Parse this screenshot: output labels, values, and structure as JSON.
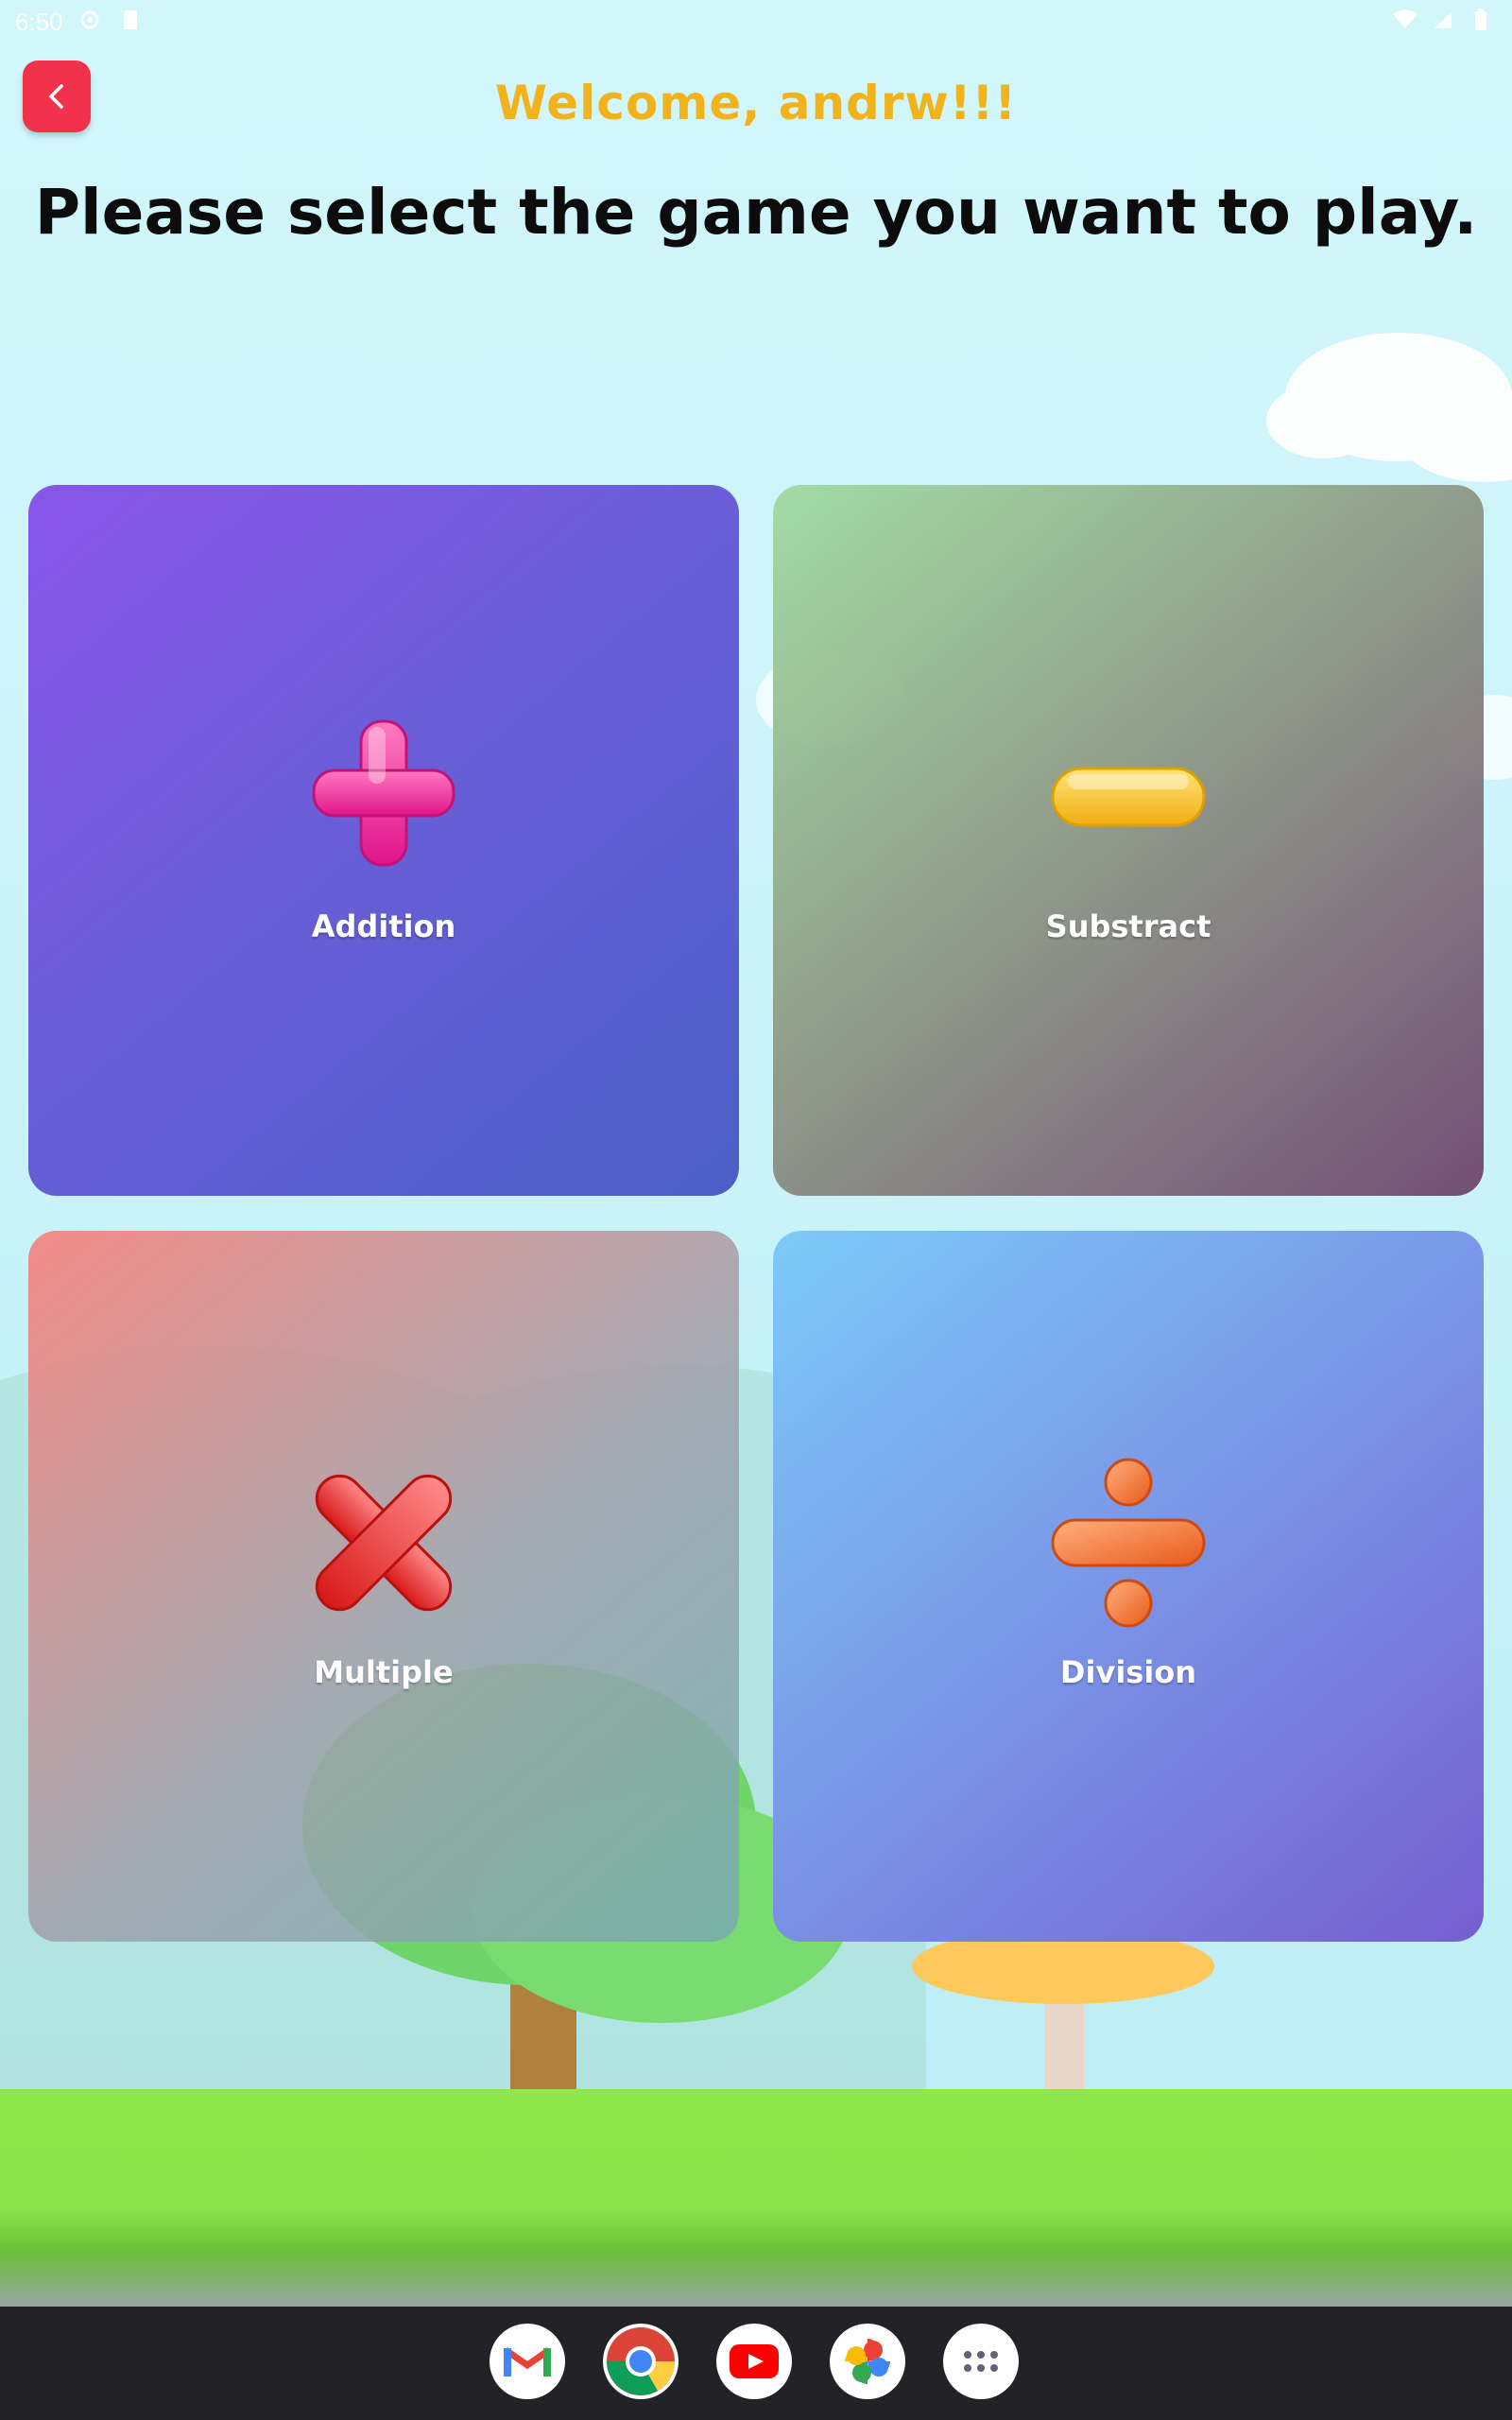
{
  "statusbar": {
    "time": "6:50"
  },
  "header": {
    "welcome": "Welcome, andrw!!!",
    "title": "Please select the game you want to play."
  },
  "games": [
    {
      "label": "Addition",
      "icon": "plus-icon"
    },
    {
      "label": "Substract",
      "icon": "minus-icon"
    },
    {
      "label": "Multiple",
      "icon": "multiply-icon"
    },
    {
      "label": "Division",
      "icon": "divide-icon"
    }
  ],
  "dock": [
    "gmail-icon",
    "chrome-icon",
    "youtube-icon",
    "photos-icon",
    "app-drawer-icon"
  ],
  "colors": {
    "welcome": "#f2b21b",
    "back_button": "#f2324b",
    "title": "#0c0c0c"
  }
}
